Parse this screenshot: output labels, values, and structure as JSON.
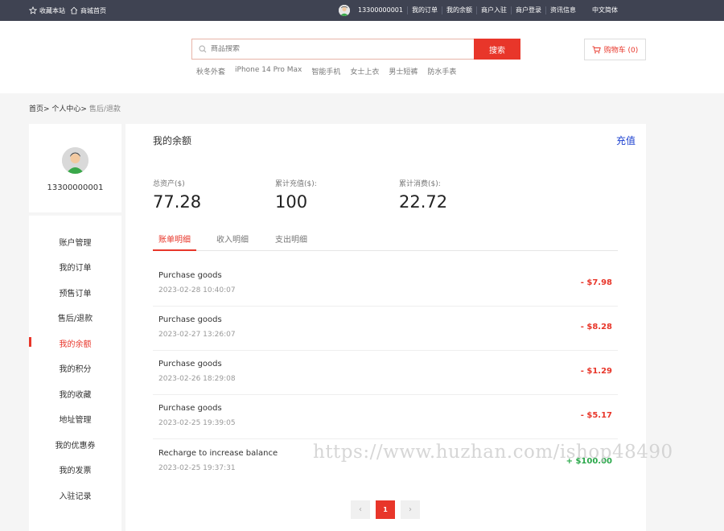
{
  "topbar": {
    "favorite": "收藏本站",
    "home": "商城首页",
    "user": "13300000001",
    "links": [
      "我的订单",
      "我的余额",
      "商户入驻",
      "商户登录",
      "资讯信息"
    ],
    "language": "中文简体"
  },
  "search": {
    "placeholder": "商品搜索",
    "button": "搜索",
    "hot_words": [
      "秋冬外套",
      "iPhone 14 Pro Max",
      "智能手机",
      "女士上衣",
      "男士短裤",
      "防水手表"
    ]
  },
  "cart": {
    "label": "购物车 (0)"
  },
  "breadcrumb": {
    "home": "首页>",
    "center": "个人中心>",
    "current": "售后/退款"
  },
  "profile": {
    "username": "13300000001"
  },
  "menu": [
    {
      "label": "账户管理"
    },
    {
      "label": "我的订单"
    },
    {
      "label": "预售订单"
    },
    {
      "label": "售后/退款"
    },
    {
      "label": "我的余额"
    },
    {
      "label": "我的积分"
    },
    {
      "label": "我的收藏"
    },
    {
      "label": "地址管理"
    },
    {
      "label": "我的优惠券"
    },
    {
      "label": "我的发票"
    },
    {
      "label": "入驻记录"
    }
  ],
  "menu_active": "我的余额",
  "balance": {
    "title": "我的余额",
    "recharge": "充值",
    "stats": [
      {
        "label": "总资产($)",
        "value": "77.28"
      },
      {
        "label": "累计充值($):",
        "value": "100"
      },
      {
        "label": "累计消费($):",
        "value": "22.72"
      }
    ],
    "tabs": [
      "账单明细",
      "收入明细",
      "支出明细"
    ],
    "transactions": [
      {
        "title": "Purchase goods",
        "date": "2023-02-28 10:40:07",
        "amount": "- $7.98"
      },
      {
        "title": "Purchase goods",
        "date": "2023-02-27 13:26:07",
        "amount": "- $8.28"
      },
      {
        "title": "Purchase goods",
        "date": "2023-02-26 18:29:08",
        "amount": "- $1.29"
      },
      {
        "title": "Purchase goods",
        "date": "2023-02-25 19:39:05",
        "amount": "- $5.17"
      },
      {
        "title": "Recharge to increase balance",
        "date": "2023-02-25 19:37:31",
        "amount": "+ $100.00"
      }
    ],
    "pager": {
      "prev": "‹",
      "current": "1",
      "next": "›"
    }
  },
  "watermark": "https://www.huzhan.com/ishop48490",
  "colors": {
    "accent": "#e8362a",
    "topbar": "#3f4352",
    "link": "#1a3fcf",
    "positive": "#2aa84a"
  }
}
